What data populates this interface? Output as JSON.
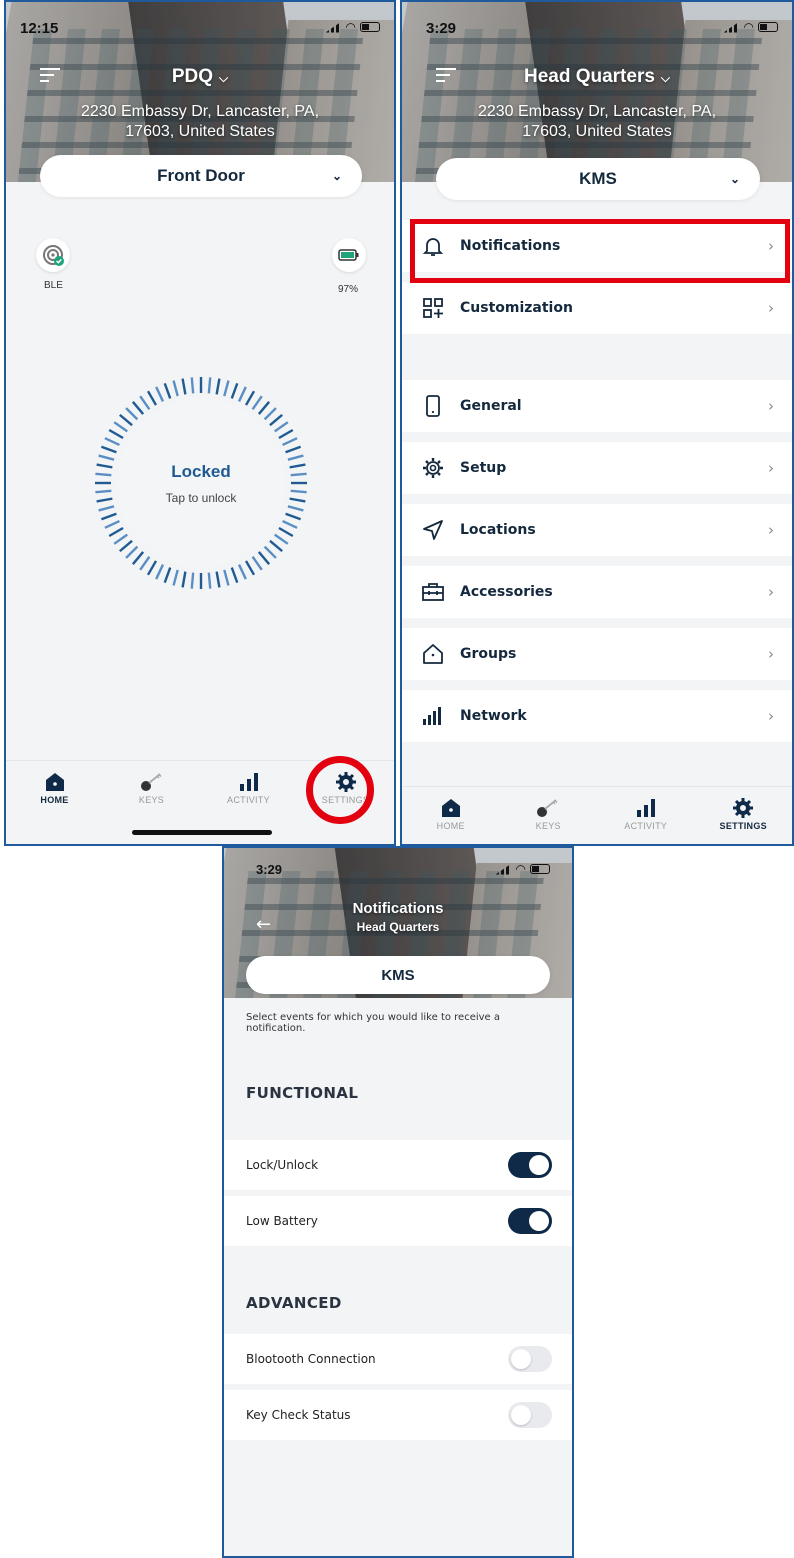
{
  "panel_home": {
    "time": "12:15",
    "location_name": "PDQ",
    "address": "2230 Embassy Dr, Lancaster, PA, 17603, United States",
    "lock_selector": "Front Door",
    "ble_label": "BLE",
    "battery_label": "97%",
    "lock_state": "Locked",
    "lock_hint": "Tap to unlock",
    "tabs": [
      {
        "label": "HOME",
        "icon": "home-icon",
        "active": true
      },
      {
        "label": "KEYS",
        "icon": "key-icon",
        "active": false
      },
      {
        "label": "ACTIVITY",
        "icon": "activity-bars-icon",
        "active": false
      },
      {
        "label": "SETTINGS",
        "icon": "gear-icon",
        "active": false
      }
    ],
    "highlight_color": "#e3000f"
  },
  "panel_settings": {
    "time": "3:29",
    "location_name": "Head Quarters",
    "address": "2230 Embassy Dr, Lancaster, PA, 17603, United States",
    "lock_selector": "KMS",
    "items": [
      {
        "label": "Notifications",
        "icon": "bell-icon"
      },
      {
        "label": "Customization",
        "icon": "grid-plus-icon"
      },
      {
        "label": "General",
        "icon": "phone-icon"
      },
      {
        "label": "Setup",
        "icon": "gear-icon"
      },
      {
        "label": "Locations",
        "icon": "navigation-arrow-icon"
      },
      {
        "label": "Accessories",
        "icon": "toolbox-icon"
      },
      {
        "label": "Groups",
        "icon": "house-outline-icon"
      },
      {
        "label": "Network",
        "icon": "signal-bars-icon"
      }
    ],
    "tabs": [
      {
        "label": "HOME",
        "icon": "home-icon",
        "active": false
      },
      {
        "label": "KEYS",
        "icon": "key-icon",
        "active": false
      },
      {
        "label": "ACTIVITY",
        "icon": "activity-bars-icon",
        "active": false
      },
      {
        "label": "SETTINGS",
        "icon": "gear-icon",
        "active": true
      }
    ]
  },
  "panel_notifications": {
    "time": "3:29",
    "title": "Notifications",
    "subtitle": "Head Quarters",
    "lock_selector": "KMS",
    "intro": "Select events for which you would like to receive a notification.",
    "sections": [
      {
        "heading": "FUNCTIONAL",
        "rows": [
          {
            "label": "Lock/Unlock",
            "enabled": true
          },
          {
            "label": "Low Battery",
            "enabled": true
          }
        ]
      },
      {
        "heading": "ADVANCED",
        "rows": [
          {
            "label": "Blootooth Connection",
            "enabled": false
          },
          {
            "label": "Key Check Status",
            "enabled": false
          }
        ]
      }
    ],
    "toggle_on_color": "#0f2a48"
  }
}
